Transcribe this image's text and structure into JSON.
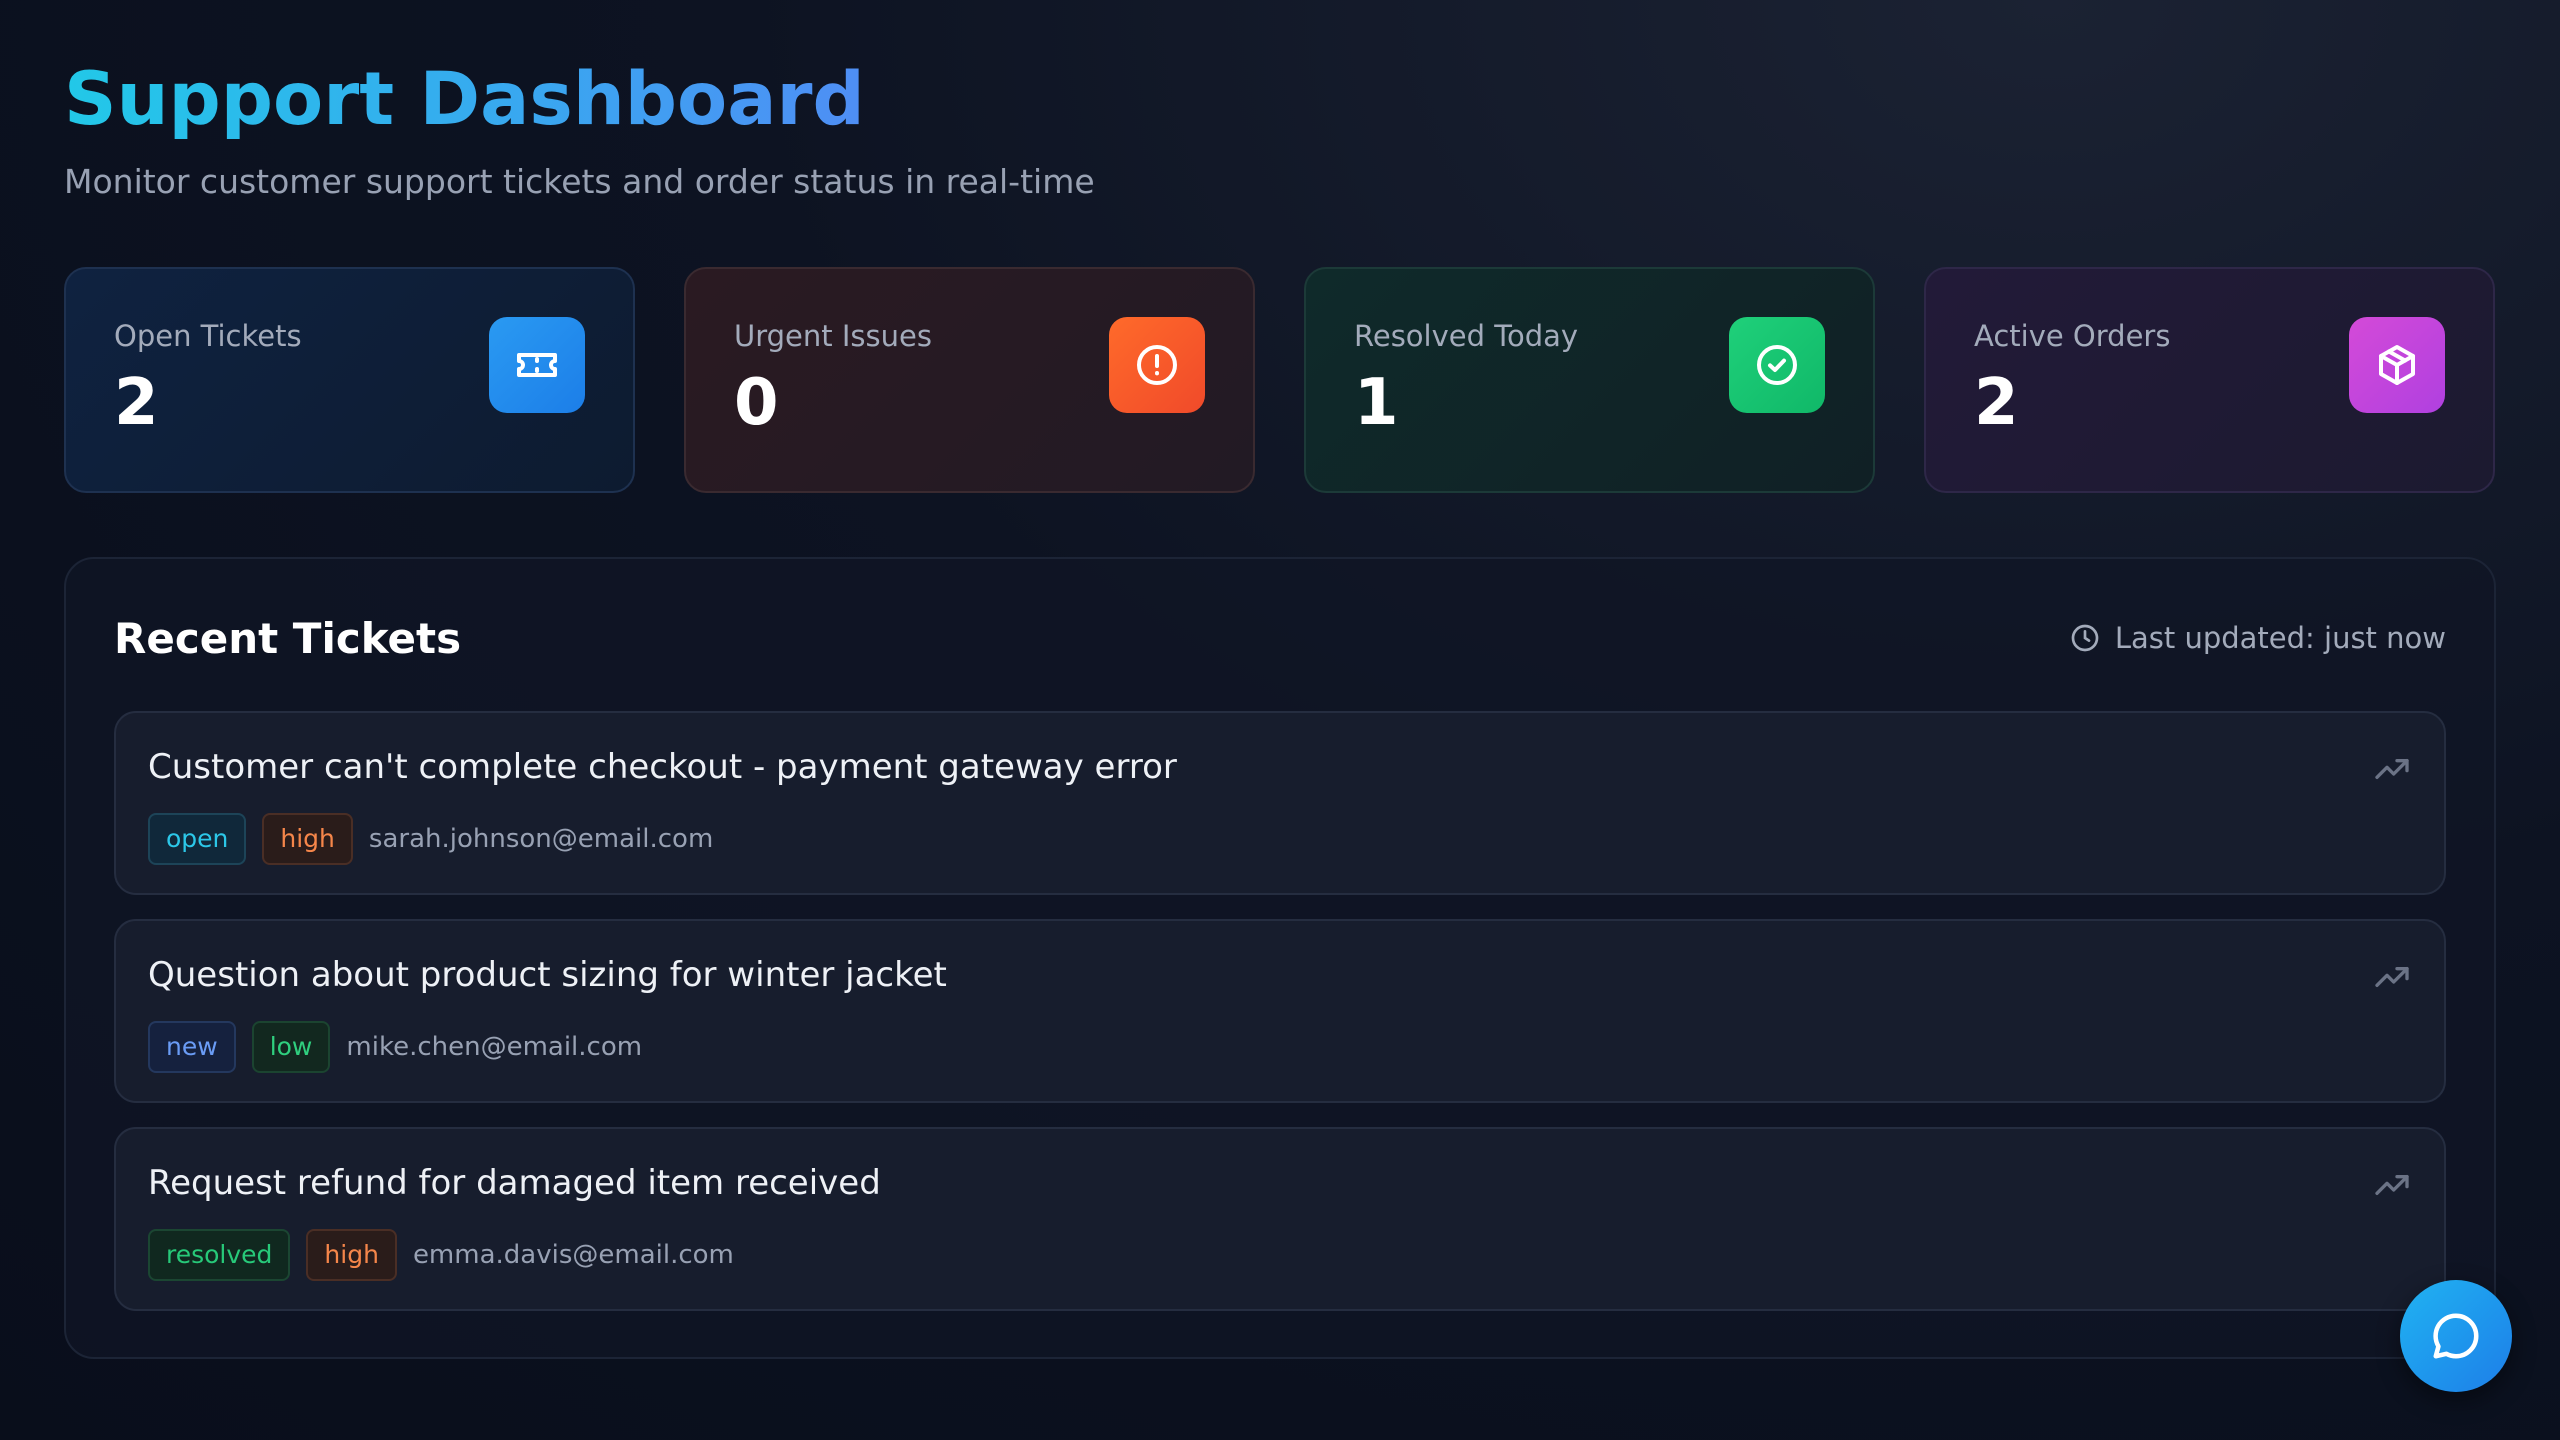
{
  "header": {
    "title": "Support Dashboard",
    "subtitle": "Monitor customer support tickets and order status in real-time"
  },
  "stats": [
    {
      "label": "Open Tickets",
      "value": "2",
      "icon": "ticket-icon",
      "color": "#2196f3"
    },
    {
      "label": "Urgent Issues",
      "value": "0",
      "icon": "alert-circle-icon",
      "color": "#ff5722"
    },
    {
      "label": "Resolved Today",
      "value": "1",
      "icon": "check-circle-icon",
      "color": "#16c172"
    },
    {
      "label": "Active Orders",
      "value": "2",
      "icon": "package-icon",
      "color": "#c84ae0"
    }
  ],
  "recent": {
    "title": "Recent Tickets",
    "updated": "Last updated: just now",
    "tickets": [
      {
        "title": "Customer can't complete checkout - payment gateway error",
        "status": "open",
        "priority": "high",
        "email": "sarah.johnson@email.com"
      },
      {
        "title": "Question about product sizing for winter jacket",
        "status": "new",
        "priority": "low",
        "email": "mike.chen@email.com"
      },
      {
        "title": "Request refund for damaged item received",
        "status": "resolved",
        "priority": "high",
        "email": "emma.davis@email.com"
      }
    ]
  }
}
